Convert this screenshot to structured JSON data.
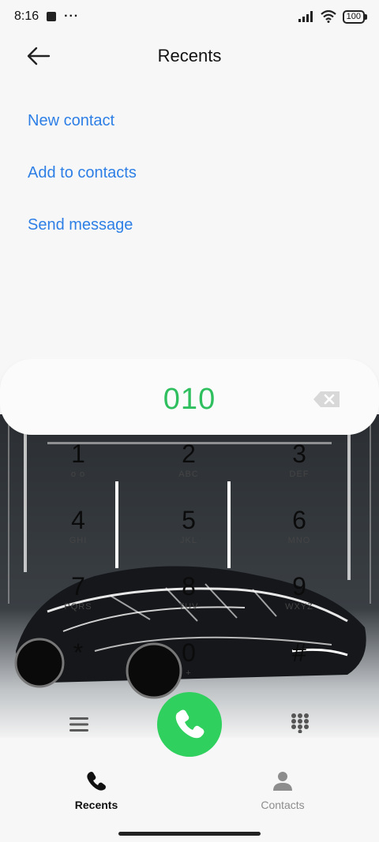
{
  "status_bar": {
    "time": "8:16",
    "dots": "···",
    "battery": "100"
  },
  "header": {
    "title": "Recents"
  },
  "actions": [
    {
      "label": "New contact"
    },
    {
      "label": "Add to contacts"
    },
    {
      "label": "Send message"
    }
  ],
  "dialer": {
    "number": "010",
    "keys": [
      {
        "digit": "1",
        "letters": "o o"
      },
      {
        "digit": "2",
        "letters": "ABC"
      },
      {
        "digit": "3",
        "letters": "DEF"
      },
      {
        "digit": "4",
        "letters": "GHI"
      },
      {
        "digit": "5",
        "letters": "JKL"
      },
      {
        "digit": "6",
        "letters": "MNO"
      },
      {
        "digit": "7",
        "letters": "PQRS"
      },
      {
        "digit": "8",
        "letters": "TUV"
      },
      {
        "digit": "9",
        "letters": "WXYZ"
      },
      {
        "digit": "*",
        "letters": ""
      },
      {
        "digit": "0",
        "letters": "+"
      },
      {
        "digit": "#",
        "letters": ""
      }
    ]
  },
  "bottom_nav": {
    "recents": "Recents",
    "contacts": "Contacts"
  },
  "colors": {
    "accent_blue": "#2d7fe6",
    "call_green": "#2fd05d",
    "number_green": "#2fbf5f"
  },
  "icons": [
    "back-arrow-icon",
    "signal-icon",
    "wifi-icon",
    "backspace-icon",
    "menu-icon",
    "phone-icon",
    "dialpad-icon",
    "person-icon"
  ]
}
